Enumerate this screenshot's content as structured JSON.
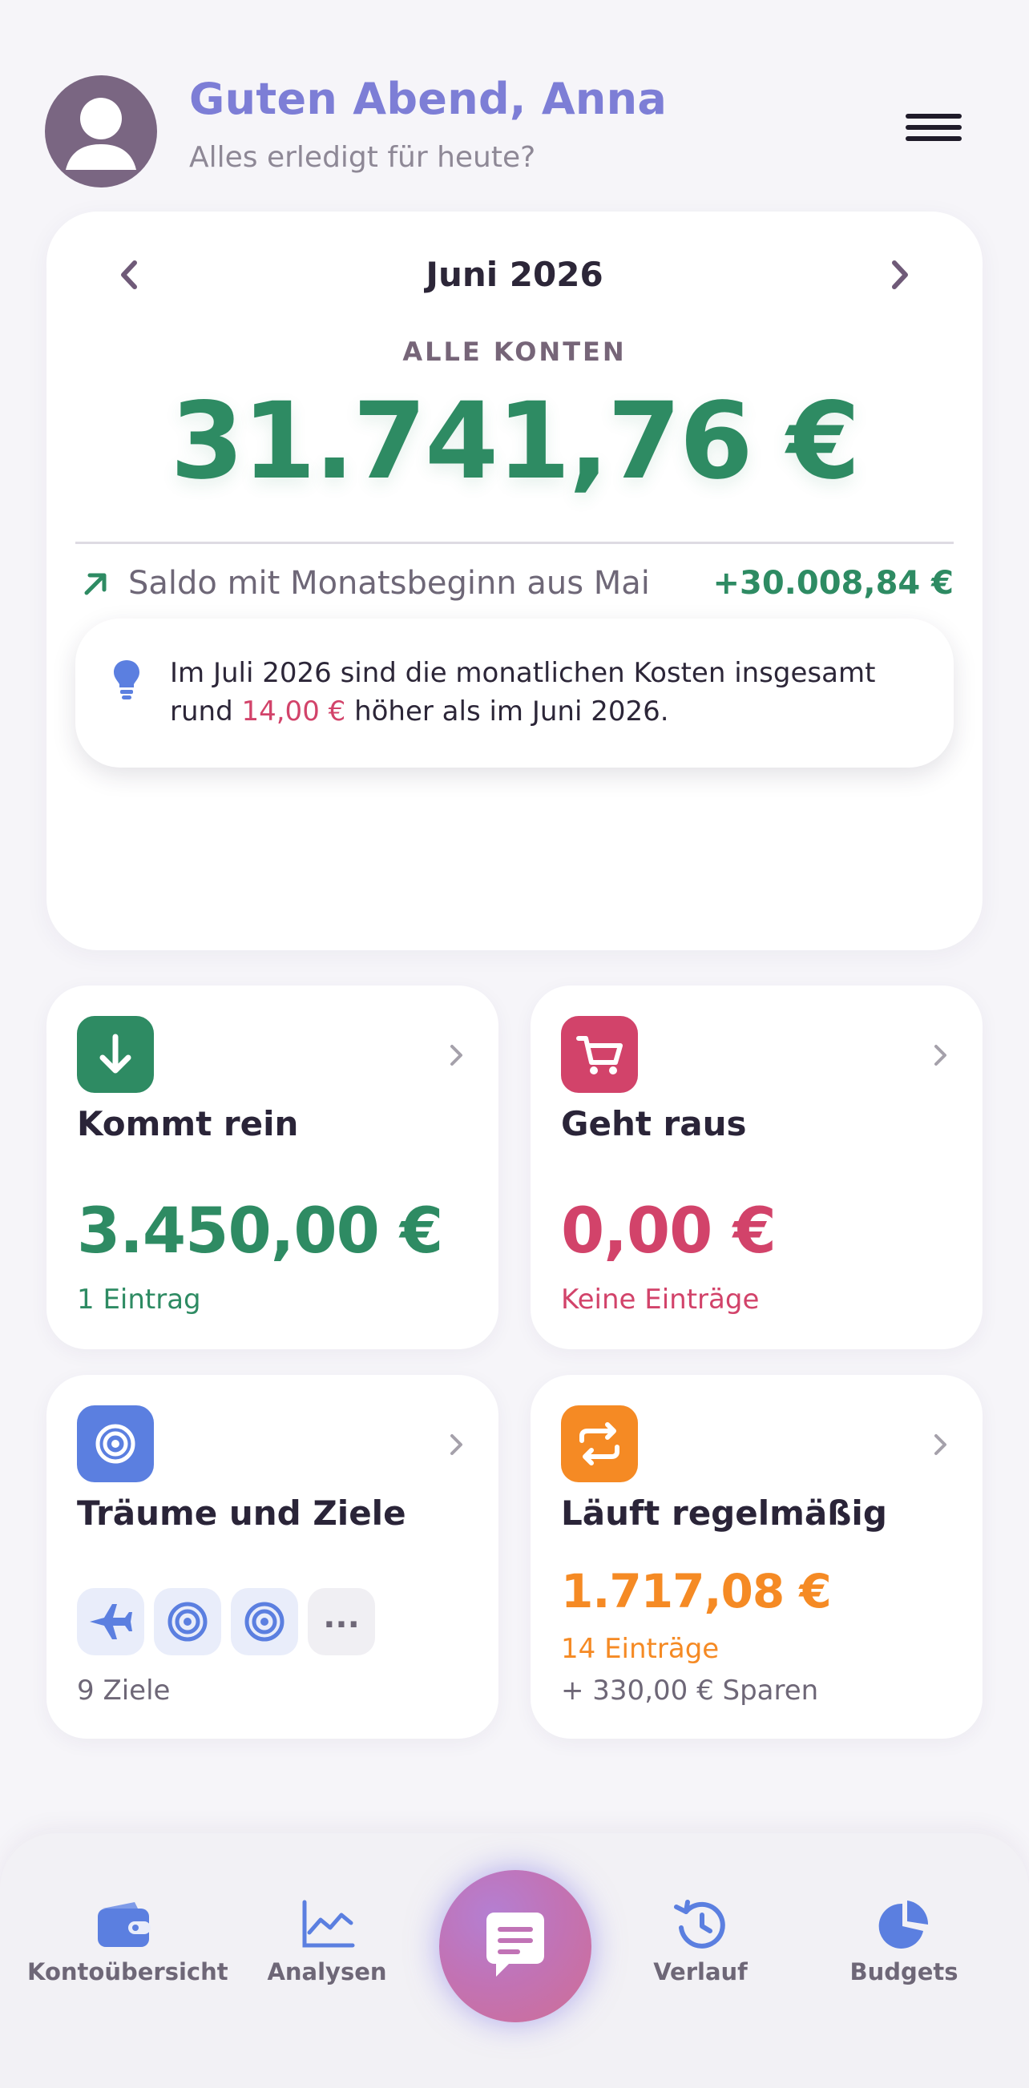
{
  "header": {
    "greeting": "Guten Abend, Anna",
    "subtitle": "Alles erledigt für heute?"
  },
  "summary": {
    "month": "Juni 2026",
    "accounts_label": "ALLE KONTEN",
    "balance": "31.741,76 €",
    "carryover_label": "Saldo mit Monatsbeginn aus Mai",
    "carryover_value": "+30.008,84 €",
    "tip_prefix": "Im Juli 2026 sind die monatlichen Kosten insgesamt rund",
    "tip_amount": "14,00 €",
    "tip_suffix": "höher als im Juni 2026."
  },
  "tiles": {
    "income": {
      "title": "Kommt rein",
      "amount": "3.450,00 €",
      "sub": "1 Eintrag"
    },
    "expenses": {
      "title": "Geht raus",
      "amount": "0,00 €",
      "sub": "Keine Einträge"
    },
    "goals": {
      "title": "Träume und Ziele",
      "more": "...",
      "sub": "9 Ziele"
    },
    "recurring": {
      "title": "Läuft regelmäßig",
      "amount": "1.717,08 €",
      "sub": "14 Einträge",
      "savings": "+ 330,00 € Sparen"
    }
  },
  "bottom_nav": {
    "items": [
      {
        "label": "Kontoübersicht",
        "icon": "wallet-icon"
      },
      {
        "label": "Analysen",
        "icon": "line-chart-icon"
      },
      {
        "label": "Verlauf",
        "icon": "history-icon"
      },
      {
        "label": "Budgets",
        "icon": "pie-chart-icon"
      }
    ],
    "center_icon": "chat-icon"
  },
  "colors": {
    "green": "#2e8b63",
    "red": "#d2436a",
    "orange": "#f58a24",
    "blue": "#5b7fe0",
    "greeting": "#7d7ed6"
  }
}
